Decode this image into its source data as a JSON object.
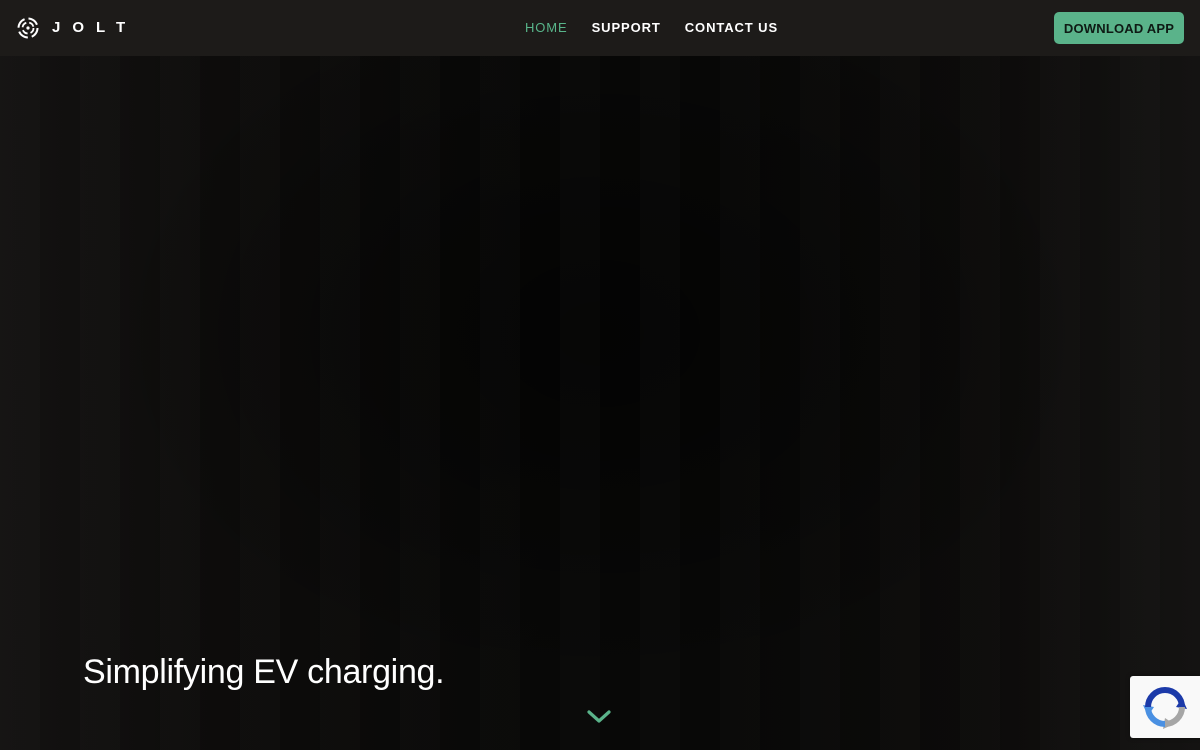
{
  "brand": {
    "name": "JOLT",
    "logo_icon": "swirl-logo-icon"
  },
  "nav": {
    "items": [
      {
        "label": "HOME",
        "active": true
      },
      {
        "label": "SUPPORT",
        "active": false
      },
      {
        "label": "CONTACT US",
        "active": false
      }
    ]
  },
  "header": {
    "download_label": "DOWNLOAD APP"
  },
  "hero": {
    "tagline": "Simplifying EV charging.",
    "scroll_icon": "chevron-down-icon"
  },
  "recaptcha": {
    "icon": "recaptcha-icon"
  },
  "colors": {
    "accent": "#5ab38a",
    "header_bg": "#1d1b19",
    "hero_bg": "#0b0a09",
    "text": "#ffffff"
  }
}
